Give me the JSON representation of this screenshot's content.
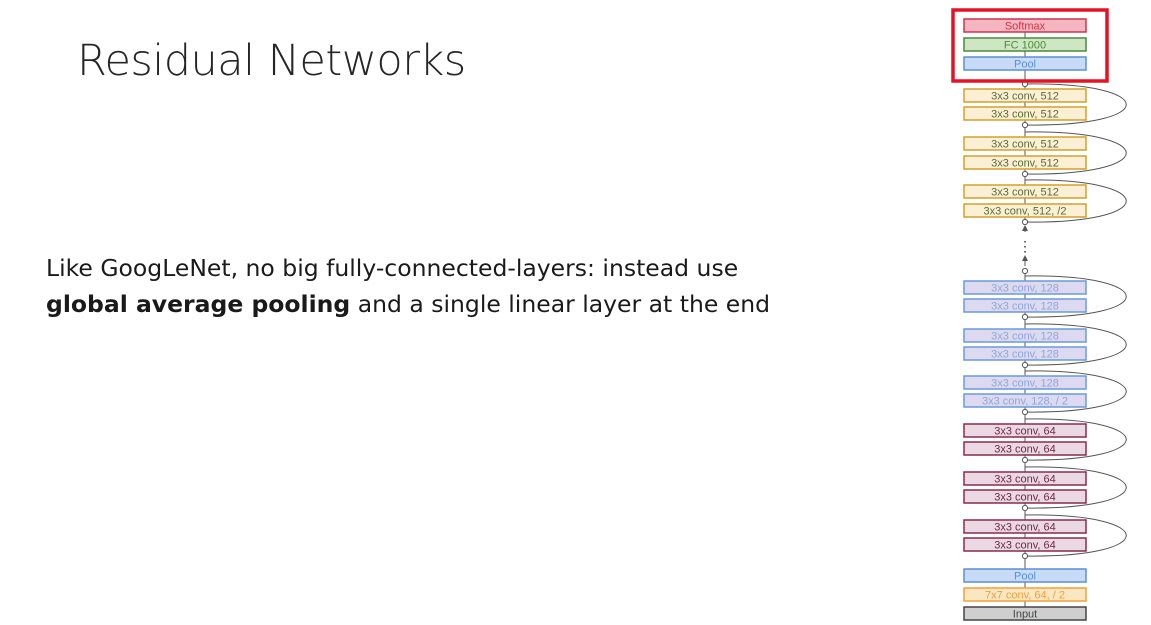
{
  "slide": {
    "title": "Residual Networks",
    "text_line1": "Like GoogLeNet, no big fully-connected-layers: instead use",
    "text_bold": "global average pooling",
    "text_line2_rest": " and a single linear layer at the end"
  },
  "colors": {
    "highlight": "#e81123",
    "softmax_fill": "#f4b6c0",
    "softmax_stroke": "#d0344a",
    "softmax_text": "#d0344a",
    "fc_fill": "#cfe6c4",
    "fc_stroke": "#4c8a3c",
    "fc_text": "#4c8a3c",
    "pool_fill": "#c7daf6",
    "pool_stroke": "#5a8fd6",
    "pool_text": "#5a8fd6",
    "c512_fill": "#fbf0d6",
    "c512_stroke": "#d3a128",
    "c512_text": "#5b6a35",
    "c128_fill": "#dcd9f0",
    "c128_stroke": "#6b9bd8",
    "c128_text": "#8fa7dc",
    "c64_fill": "#ead8e2",
    "c64_stroke": "#8a2b4f",
    "c64_text": "#6e2b4a",
    "c7_fill": "#fbe6c2",
    "c7_stroke": "#f1a03a",
    "c7_text": "#f1a03a",
    "input_fill": "#cfcfcf",
    "input_stroke": "#444444",
    "input_text": "#444444"
  },
  "diagram": {
    "layers": [
      {
        "label": "Softmax",
        "kind": "softmax"
      },
      {
        "label": "FC 1000",
        "kind": "fc"
      },
      {
        "label": "Pool",
        "kind": "pool"
      },
      {
        "label": "3x3 conv, 512",
        "kind": "c512"
      },
      {
        "label": "3x3 conv, 512",
        "kind": "c512"
      },
      {
        "label": "3x3 conv, 512",
        "kind": "c512"
      },
      {
        "label": "3x3 conv, 512",
        "kind": "c512"
      },
      {
        "label": "3x3 conv, 512",
        "kind": "c512"
      },
      {
        "label": "3x3 conv, 512, /2",
        "kind": "c512"
      },
      {
        "label": "3x3 conv, 128",
        "kind": "c128"
      },
      {
        "label": "3x3 conv, 128",
        "kind": "c128"
      },
      {
        "label": "3x3 conv, 128",
        "kind": "c128"
      },
      {
        "label": "3x3 conv, 128",
        "kind": "c128"
      },
      {
        "label": "3x3 conv, 128",
        "kind": "c128"
      },
      {
        "label": "3x3 conv, 128, / 2",
        "kind": "c128"
      },
      {
        "label": "3x3 conv, 64",
        "kind": "c64"
      },
      {
        "label": "3x3 conv, 64",
        "kind": "c64"
      },
      {
        "label": "3x3 conv, 64",
        "kind": "c64"
      },
      {
        "label": "3x3 conv, 64",
        "kind": "c64"
      },
      {
        "label": "3x3 conv, 64",
        "kind": "c64"
      },
      {
        "label": "3x3 conv, 64",
        "kind": "c64"
      },
      {
        "label": "Pool",
        "kind": "pool"
      },
      {
        "label": "7x7 conv, 64, / 2",
        "kind": "c7"
      },
      {
        "label": "Input",
        "kind": "input"
      }
    ],
    "gap_marker": "⋮"
  }
}
